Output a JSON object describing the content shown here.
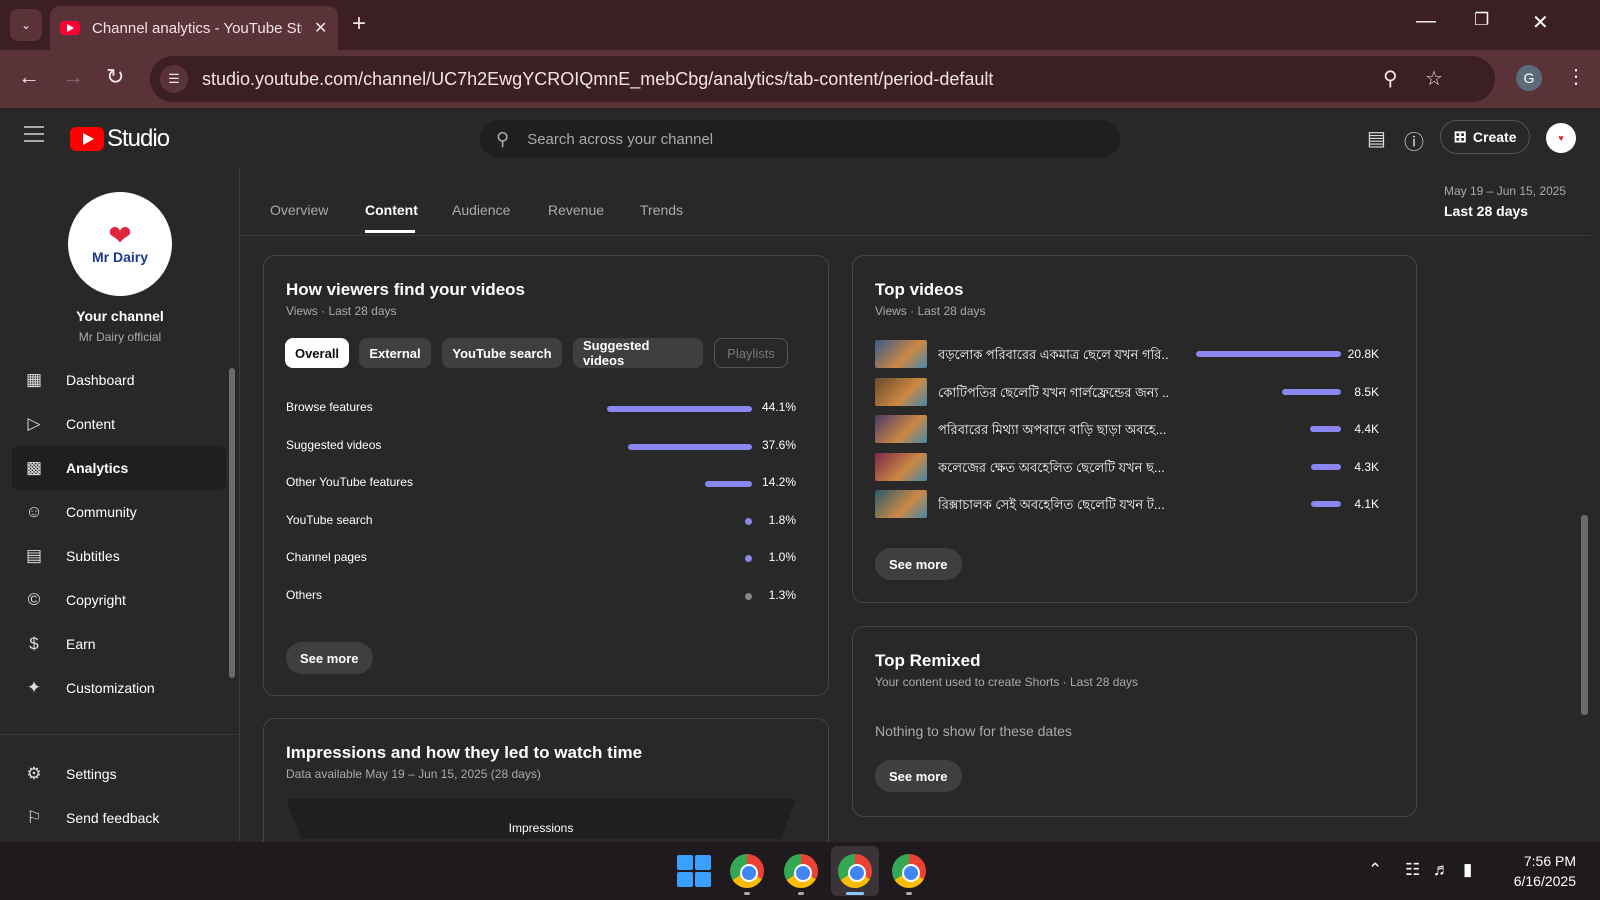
{
  "browser": {
    "tab_title": "Channel analytics - YouTube Studio",
    "url": "studio.youtube.com/channel/UC7h2EwgYCROIQmnE_mebCbg/analytics/tab-content/period-default",
    "profile_initial": "G"
  },
  "studio": {
    "logo_text": "Studio",
    "search_placeholder": "Search across your channel",
    "create_label": "Create"
  },
  "sidebar": {
    "channel_avatar_text": "Mr Dairy",
    "channel_title": "Your channel",
    "channel_name": "Mr Dairy official",
    "items": [
      {
        "label": "Dashboard",
        "icon": "dashboard-icon"
      },
      {
        "label": "Content",
        "icon": "content-icon"
      },
      {
        "label": "Analytics",
        "icon": "analytics-icon"
      },
      {
        "label": "Community",
        "icon": "community-icon"
      },
      {
        "label": "Subtitles",
        "icon": "subtitles-icon"
      },
      {
        "label": "Copyright",
        "icon": "copyright-icon"
      },
      {
        "label": "Earn",
        "icon": "earn-icon"
      },
      {
        "label": "Customization",
        "icon": "customization-icon"
      }
    ],
    "bottom_items": [
      {
        "label": "Settings",
        "icon": "settings-icon"
      },
      {
        "label": "Send feedback",
        "icon": "feedback-icon"
      }
    ]
  },
  "tabs": [
    "Overview",
    "Content",
    "Audience",
    "Revenue",
    "Trends"
  ],
  "active_tab": "Content",
  "period": {
    "range": "May 19 – Jun 15, 2025",
    "label": "Last 28 days"
  },
  "traffic_sources": {
    "title": "How viewers find your videos",
    "subtitle": "Views · Last 28 days",
    "chips": [
      "Overall",
      "External",
      "YouTube search",
      "Suggested videos",
      "Playlists"
    ],
    "selected_chip": "Overall",
    "rows": [
      {
        "label": "Browse features",
        "value": "44.1%",
        "fraction": 0.441
      },
      {
        "label": "Suggested videos",
        "value": "37.6%",
        "fraction": 0.376
      },
      {
        "label": "Other YouTube features",
        "value": "14.2%",
        "fraction": 0.142
      },
      {
        "label": "YouTube search",
        "value": "1.8%",
        "fraction": 0.018
      },
      {
        "label": "Channel pages",
        "value": "1.0%",
        "fraction": 0.01
      },
      {
        "label": "Others",
        "value": "1.3%",
        "fraction": 0.013
      }
    ],
    "see_more": "See more"
  },
  "impressions": {
    "title": "Impressions and how they led to watch time",
    "subtitle": "Data available May 19 – Jun 15, 2025 (28 days)",
    "funnel_label": "Impressions"
  },
  "top_videos": {
    "title": "Top videos",
    "subtitle": "Views · Last 28 days",
    "rows": [
      {
        "title": "বড়লোক পরিবারের একমাত্র ছেলে যখন গরি...",
        "value": "20.8K",
        "fraction": 1.0
      },
      {
        "title": "কোটিপতির ছেলেটি যখন গার্লফ্রেন্ডের জন্য ...",
        "value": "8.5K",
        "fraction": 0.409
      },
      {
        "title": "পরিবারের মিথ্যা অপবাদে বাড়ি ছাড়া অবহে...",
        "value": "4.4K",
        "fraction": 0.212
      },
      {
        "title": "কলেজের ক্ষেত অবহেলিত ছেলেটি যখন ছ...",
        "value": "4.3K",
        "fraction": 0.207
      },
      {
        "title": "রিক্সাচালক সেই অবহেলিত ছেলেটি যখন ট...",
        "value": "4.1K",
        "fraction": 0.197
      }
    ],
    "see_more": "See more"
  },
  "top_remixed": {
    "title": "Top Remixed",
    "subtitle": "Your content used to create Shorts · Last 28 days",
    "empty": "Nothing to show for these dates",
    "see_more": "See more"
  },
  "taskbar": {
    "time": "7:56 PM",
    "date": "6/16/2025"
  },
  "colors": {
    "accent_bar": "#8b86f0",
    "dot_other": "#888888"
  }
}
